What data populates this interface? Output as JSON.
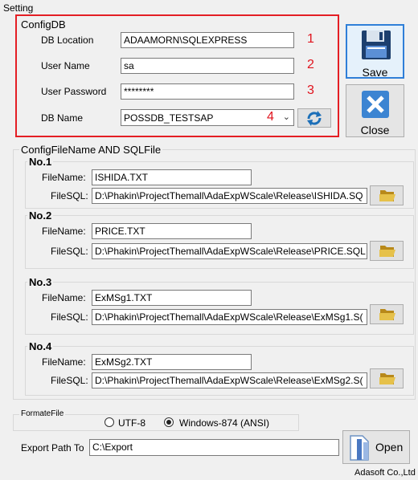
{
  "window": {
    "title": "Setting"
  },
  "config_db": {
    "title": "ConfigDB",
    "fields": {
      "location": {
        "label": "DB Location",
        "value": "ADAAMORN\\SQLEXPRESS",
        "marker": "1"
      },
      "user": {
        "label": "User Name",
        "value": "sa",
        "marker": "2"
      },
      "password": {
        "label": "User Password",
        "value": "********",
        "marker": "3"
      },
      "dbname": {
        "label": "DB Name",
        "value": "POSSDB_TESTSAP",
        "marker": "4"
      }
    }
  },
  "buttons": {
    "save": "Save",
    "close": "Close",
    "open": "Open"
  },
  "config_files": {
    "title": "ConfigFileName AND SQLFile",
    "filename_label": "FileName:",
    "filesql_label": "FileSQL:",
    "items": [
      {
        "title": "No.1",
        "filename": "ISHIDA.TXT",
        "filesql": "D:\\Phakin\\ProjectThemall\\AdaExpWScale\\Release\\ISHIDA.SQ"
      },
      {
        "title": "No.2",
        "filename": "PRICE.TXT",
        "filesql": "D:\\Phakin\\ProjectThemall\\AdaExpWScale\\Release\\PRICE.SQL"
      },
      {
        "title": "No.3",
        "filename": "ExMSg1.TXT",
        "filesql": "D:\\Phakin\\ProjectThemall\\AdaExpWScale\\Release\\ExMSg1.S("
      },
      {
        "title": "No.4",
        "filename": "ExMSg2.TXT",
        "filesql": "D:\\Phakin\\ProjectThemall\\AdaExpWScale\\Release\\ExMSg2.S("
      }
    ]
  },
  "format_file": {
    "title": "FormateFile",
    "options": [
      {
        "label": "UTF-8",
        "selected": false
      },
      {
        "label": "Windows-874  (ANSI)",
        "selected": true
      }
    ]
  },
  "export": {
    "label": "Export Path To",
    "value": "C:\\Export"
  },
  "footer": {
    "company": "Adasoft Co.,Ltd"
  }
}
